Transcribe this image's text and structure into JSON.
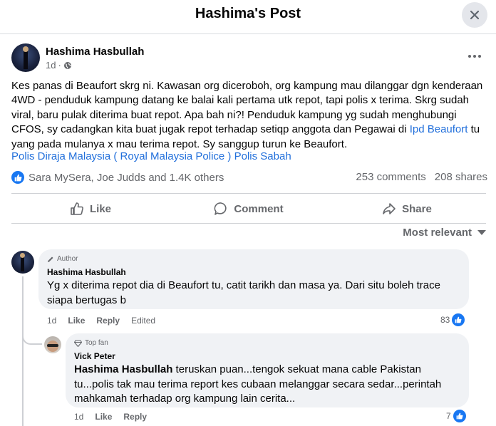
{
  "dialog": {
    "title": "Hashima's Post"
  },
  "post": {
    "author": "Hashima Hasbullah",
    "time": "1d",
    "body_part1": "Kes panas di Beaufort skrg ni. Kawasan org diceroboh, org kampung mau dilanggar dgn kenderaan 4WD - penduduk kampung datang ke balai kali pertama utk repot, tapi polis x terima. Skrg sudah viral, baru pulak diterima buat repot. Apa bah ni?! Penduduk kampung yg sudah menghubungi CFOS, sy cadangkan kita buat jugak repot terhadap setiqp anggota dan Pegawai di ",
    "body_link": "Ipd Beaufort",
    "body_part2": " tu yang pada mulanya x mau terima repot. Sy sanggup turun ke Beaufort.",
    "tag1": "Polis Diraja Malaysia ( Royal Malaysia Police )",
    "tag2": "Polis Sabah",
    "reactions_text": "Sara MySera, Joe Judds and 1.4K others",
    "comments_count": "253 comments",
    "shares_count": "208 shares"
  },
  "actions": {
    "like": "Like",
    "comment": "Comment",
    "share": "Share"
  },
  "sort_label": "Most relevant",
  "comments": [
    {
      "badge": "Author",
      "name": "Hashima Hasbullah",
      "text": "Yg x diterima repot dia di Beaufort tu, catit tarikh dan masa ya. Dari situ boleh trace siapa bertugas b",
      "time": "1d",
      "like": "Like",
      "reply": "Reply",
      "edited": "Edited",
      "reaction_count": "83"
    },
    {
      "badge": "Top fan",
      "name": "Vick Peter",
      "mention": "Hashima Hasbullah",
      "text": " teruskan puan...tengok sekuat mana cable Pakistan tu...polis tak mau terima report kes cubaan melanggar secara sedar...perintah mahkamah terhadap org kampung lain cerita...",
      "time": "1d",
      "like": "Like",
      "reply": "Reply",
      "reaction_count": "7"
    }
  ],
  "colors": {
    "accent": "#1877f2",
    "link": "#216fdb",
    "muted": "#65676b",
    "bubble": "#f0f2f5"
  }
}
